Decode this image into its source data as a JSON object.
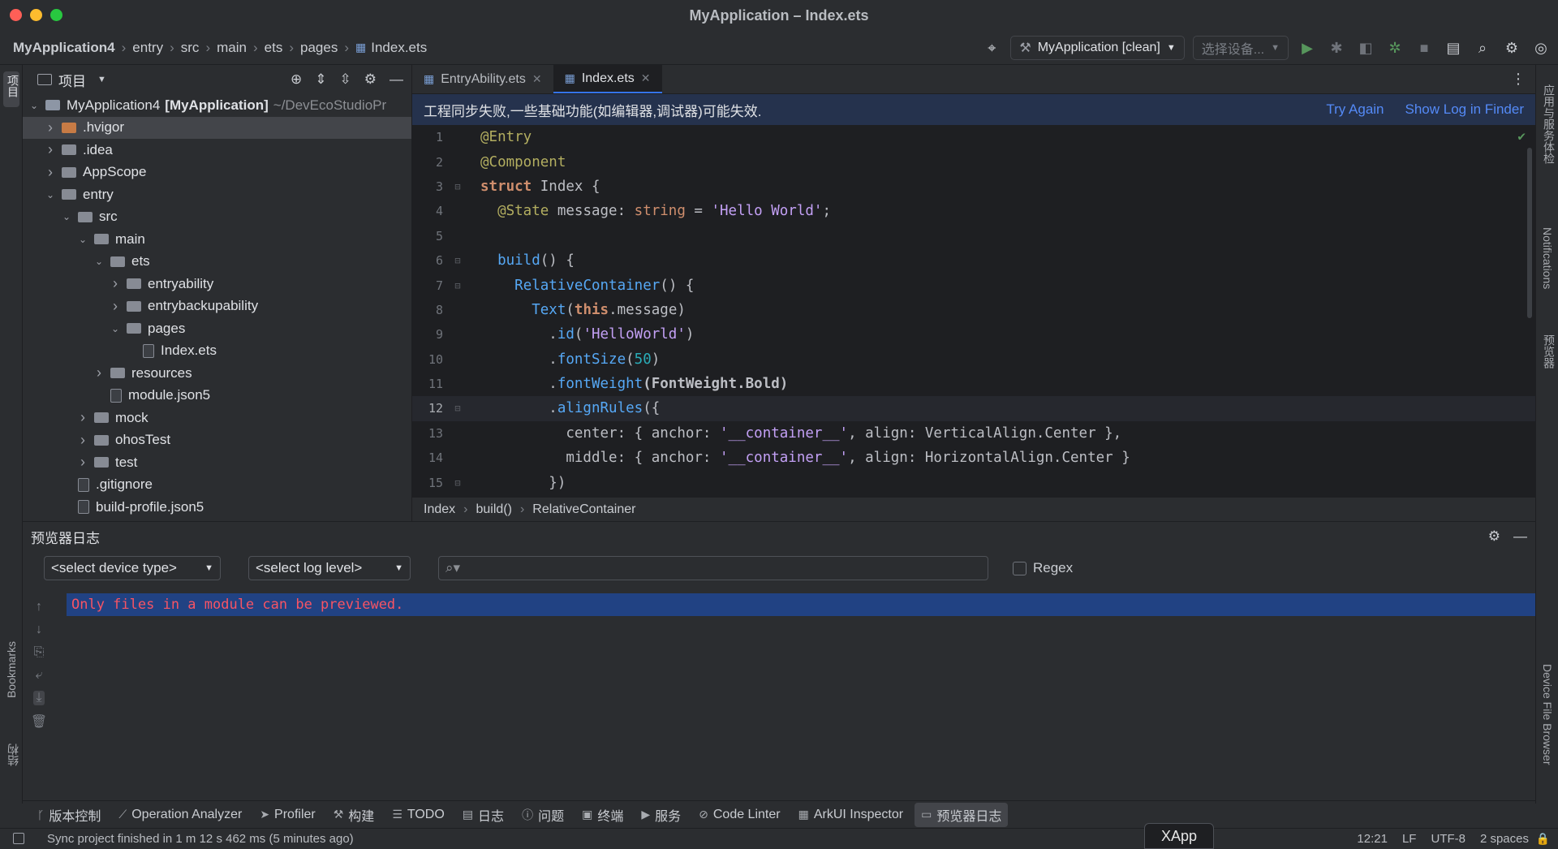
{
  "window": {
    "title": "MyApplication – Index.ets",
    "traffic_colors": [
      "#ff5f57",
      "#febc2e",
      "#28c840"
    ]
  },
  "navbar": {
    "breadcrumbs": [
      "MyApplication4",
      "entry",
      "src",
      "main",
      "ets",
      "pages",
      "Index.ets"
    ],
    "run_config": "MyApplication [clean]",
    "device_select": "选择设备..."
  },
  "left_strip": {
    "project_label": "项目",
    "bookmarks_label": "Bookmarks",
    "structure_label": "结构"
  },
  "right_strip": {
    "services_label": "应用与服务体检",
    "notifications_label": "Notifications",
    "previewer_label": "预览器",
    "device_file_browser_label": "Device File Browser"
  },
  "project_panel": {
    "title": "项目",
    "root": {
      "name": "MyApplication4",
      "module": "[MyApplication]",
      "path": "~/DevEcoStudioPr"
    },
    "items": [
      {
        "label": ".hvigor",
        "kind": "folder-orange",
        "depth": 1,
        "expanded": false
      },
      {
        "label": ".idea",
        "kind": "folder",
        "depth": 1,
        "expanded": false
      },
      {
        "label": "AppScope",
        "kind": "folder",
        "depth": 1,
        "expanded": false
      },
      {
        "label": "entry",
        "kind": "folder",
        "depth": 1,
        "expanded": true
      },
      {
        "label": "src",
        "kind": "folder",
        "depth": 2,
        "expanded": true
      },
      {
        "label": "main",
        "kind": "folder",
        "depth": 3,
        "expanded": true
      },
      {
        "label": "ets",
        "kind": "folder",
        "depth": 4,
        "expanded": true
      },
      {
        "label": "entryability",
        "kind": "folder",
        "depth": 5,
        "expanded": false
      },
      {
        "label": "entrybackupability",
        "kind": "folder",
        "depth": 5,
        "expanded": false
      },
      {
        "label": "pages",
        "kind": "folder",
        "depth": 5,
        "expanded": true
      },
      {
        "label": "Index.ets",
        "kind": "file",
        "depth": 6
      },
      {
        "label": "resources",
        "kind": "folder",
        "depth": 4,
        "expanded": false
      },
      {
        "label": "module.json5",
        "kind": "file",
        "depth": 4
      },
      {
        "label": "mock",
        "kind": "folder",
        "depth": 3,
        "expanded": false
      },
      {
        "label": "ohosTest",
        "kind": "folder",
        "depth": 3,
        "expanded": false
      },
      {
        "label": "test",
        "kind": "folder",
        "depth": 3,
        "expanded": false
      },
      {
        "label": ".gitignore",
        "kind": "file",
        "depth": 2
      },
      {
        "label": "build-profile.json5",
        "kind": "file",
        "depth": 2
      }
    ]
  },
  "editor": {
    "tabs": [
      {
        "label": "EntryAbility.ets",
        "active": false
      },
      {
        "label": "Index.ets",
        "active": true
      }
    ],
    "banner": {
      "message": "工程同步失败,一些基础功能(如编辑器,调试器)可能失效.",
      "try_again": "Try Again",
      "show_log": "Show Log in Finder"
    },
    "current_line": 12,
    "code_lines": [
      [
        {
          "t": "@Entry",
          "c": "ann"
        }
      ],
      [
        {
          "t": "@Component",
          "c": "ann"
        }
      ],
      [
        {
          "t": "struct",
          "c": "kw"
        },
        {
          "t": " Index ",
          "c": "plain"
        },
        {
          "t": "{",
          "c": "plain"
        }
      ],
      [
        {
          "t": "  ",
          "c": "plain"
        },
        {
          "t": "@State",
          "c": "ann"
        },
        {
          "t": " message: ",
          "c": "plain"
        },
        {
          "t": "string",
          "c": "kw"
        },
        {
          "t": " = ",
          "c": "plain"
        },
        {
          "t": "'Hello World'",
          "c": "str"
        },
        {
          "t": ";",
          "c": "plain"
        }
      ],
      [],
      [
        {
          "t": "  ",
          "c": "plain"
        },
        {
          "t": "build",
          "c": "fn"
        },
        {
          "t": "() {",
          "c": "plain"
        }
      ],
      [
        {
          "t": "    ",
          "c": "plain"
        },
        {
          "t": "RelativeContainer",
          "c": "fn"
        },
        {
          "t": "() {",
          "c": "plain"
        }
      ],
      [
        {
          "t": "      ",
          "c": "plain"
        },
        {
          "t": "Text",
          "c": "fn"
        },
        {
          "t": "(",
          "c": "plain"
        },
        {
          "t": "this",
          "c": "kw"
        },
        {
          "t": ".message)",
          "c": "plain"
        }
      ],
      [
        {
          "t": "        .",
          "c": "plain"
        },
        {
          "t": "id",
          "c": "fn"
        },
        {
          "t": "(",
          "c": "plain"
        },
        {
          "t": "'HelloWorld'",
          "c": "str"
        },
        {
          "t": ")",
          "c": "plain"
        }
      ],
      [
        {
          "t": "        .",
          "c": "plain"
        },
        {
          "t": "fontSize",
          "c": "fn"
        },
        {
          "t": "(",
          "c": "plain"
        },
        {
          "t": "50",
          "c": "num"
        },
        {
          "t": ")",
          "c": "plain"
        }
      ],
      [
        {
          "t": "        .",
          "c": "plain"
        },
        {
          "t": "fontWeight",
          "c": "fn"
        },
        {
          "t": "(FontWeight.Bold)",
          "c": "plain"
        }
      ],
      [
        {
          "t": "        .",
          "c": "plain"
        },
        {
          "t": "alignRules",
          "c": "fn"
        },
        {
          "t": "({",
          "c": "plain"
        }
      ],
      [
        {
          "t": "          center: { anchor: ",
          "c": "plain"
        },
        {
          "t": "'__container__'",
          "c": "str"
        },
        {
          "t": ", align: VerticalAlign.Center },",
          "c": "plain"
        }
      ],
      [
        {
          "t": "          middle: { anchor: ",
          "c": "plain"
        },
        {
          "t": "'__container__'",
          "c": "str"
        },
        {
          "t": ", align: HorizontalAlign.Center }",
          "c": "plain"
        }
      ],
      [
        {
          "t": "        })",
          "c": "plain"
        }
      ]
    ],
    "breadcrumb": [
      "Index",
      "build()",
      "RelativeContainer"
    ]
  },
  "preview_log": {
    "title": "预览器日志",
    "device_type_placeholder": "<select device type>",
    "log_level_placeholder": "<select log level>",
    "search_value": "",
    "regex_label": "Regex",
    "message": "Only files in a module can be previewed."
  },
  "bottom_tools": [
    {
      "label": "版本控制",
      "icon": "branch-icon"
    },
    {
      "label": "Operation Analyzer",
      "icon": "chart-icon"
    },
    {
      "label": "Profiler",
      "icon": "profiler-icon"
    },
    {
      "label": "构建",
      "icon": "hammer-icon"
    },
    {
      "label": "TODO",
      "icon": "list-icon"
    },
    {
      "label": "日志",
      "icon": "log-icon"
    },
    {
      "label": "问题",
      "icon": "info-icon"
    },
    {
      "label": "终端",
      "icon": "terminal-icon"
    },
    {
      "label": "服务",
      "icon": "play-icon"
    },
    {
      "label": "Code Linter",
      "icon": "linter-icon"
    },
    {
      "label": "ArkUI Inspector",
      "icon": "inspector-icon"
    },
    {
      "label": "预览器日志",
      "icon": "preview-log-icon",
      "active": true
    }
  ],
  "statusbar": {
    "message": "Sync project finished in 1 m 12 s 462 ms (5 minutes ago)",
    "position": "12:21",
    "line_sep": "LF",
    "encoding": "UTF-8",
    "indent": "2 spaces",
    "dock_app": "XApp"
  }
}
